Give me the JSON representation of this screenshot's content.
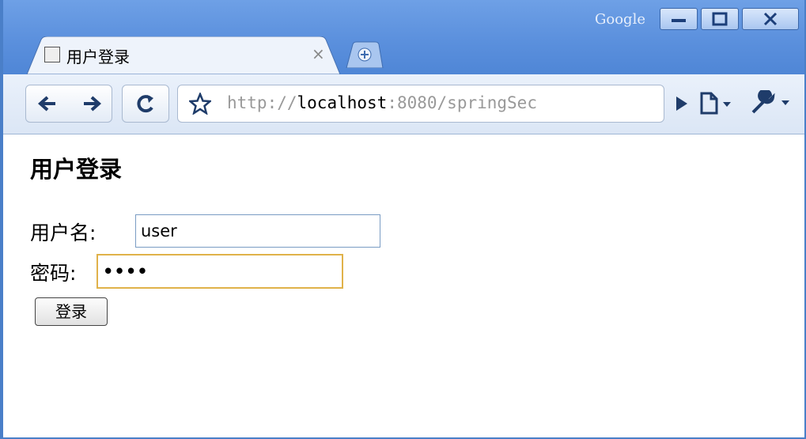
{
  "window": {
    "corner_label": "Google",
    "controls": [
      "minimize-icon",
      "maximize-icon",
      "close-icon"
    ]
  },
  "tab": {
    "title": "用户登录",
    "close_glyph": "×"
  },
  "toolbar": {
    "url_scheme": "http://",
    "url_host": "localhost",
    "url_rest": ":8080/springSec"
  },
  "page": {
    "heading": "用户登录",
    "username_label": "用户名:",
    "username_value": "user",
    "password_label": "密码:",
    "password_value": "••••",
    "login_button": "登录"
  },
  "colors": {
    "titlebar": "#5b90dd",
    "focus_border": "#e0b24a",
    "input_border": "#7a9cc4"
  }
}
